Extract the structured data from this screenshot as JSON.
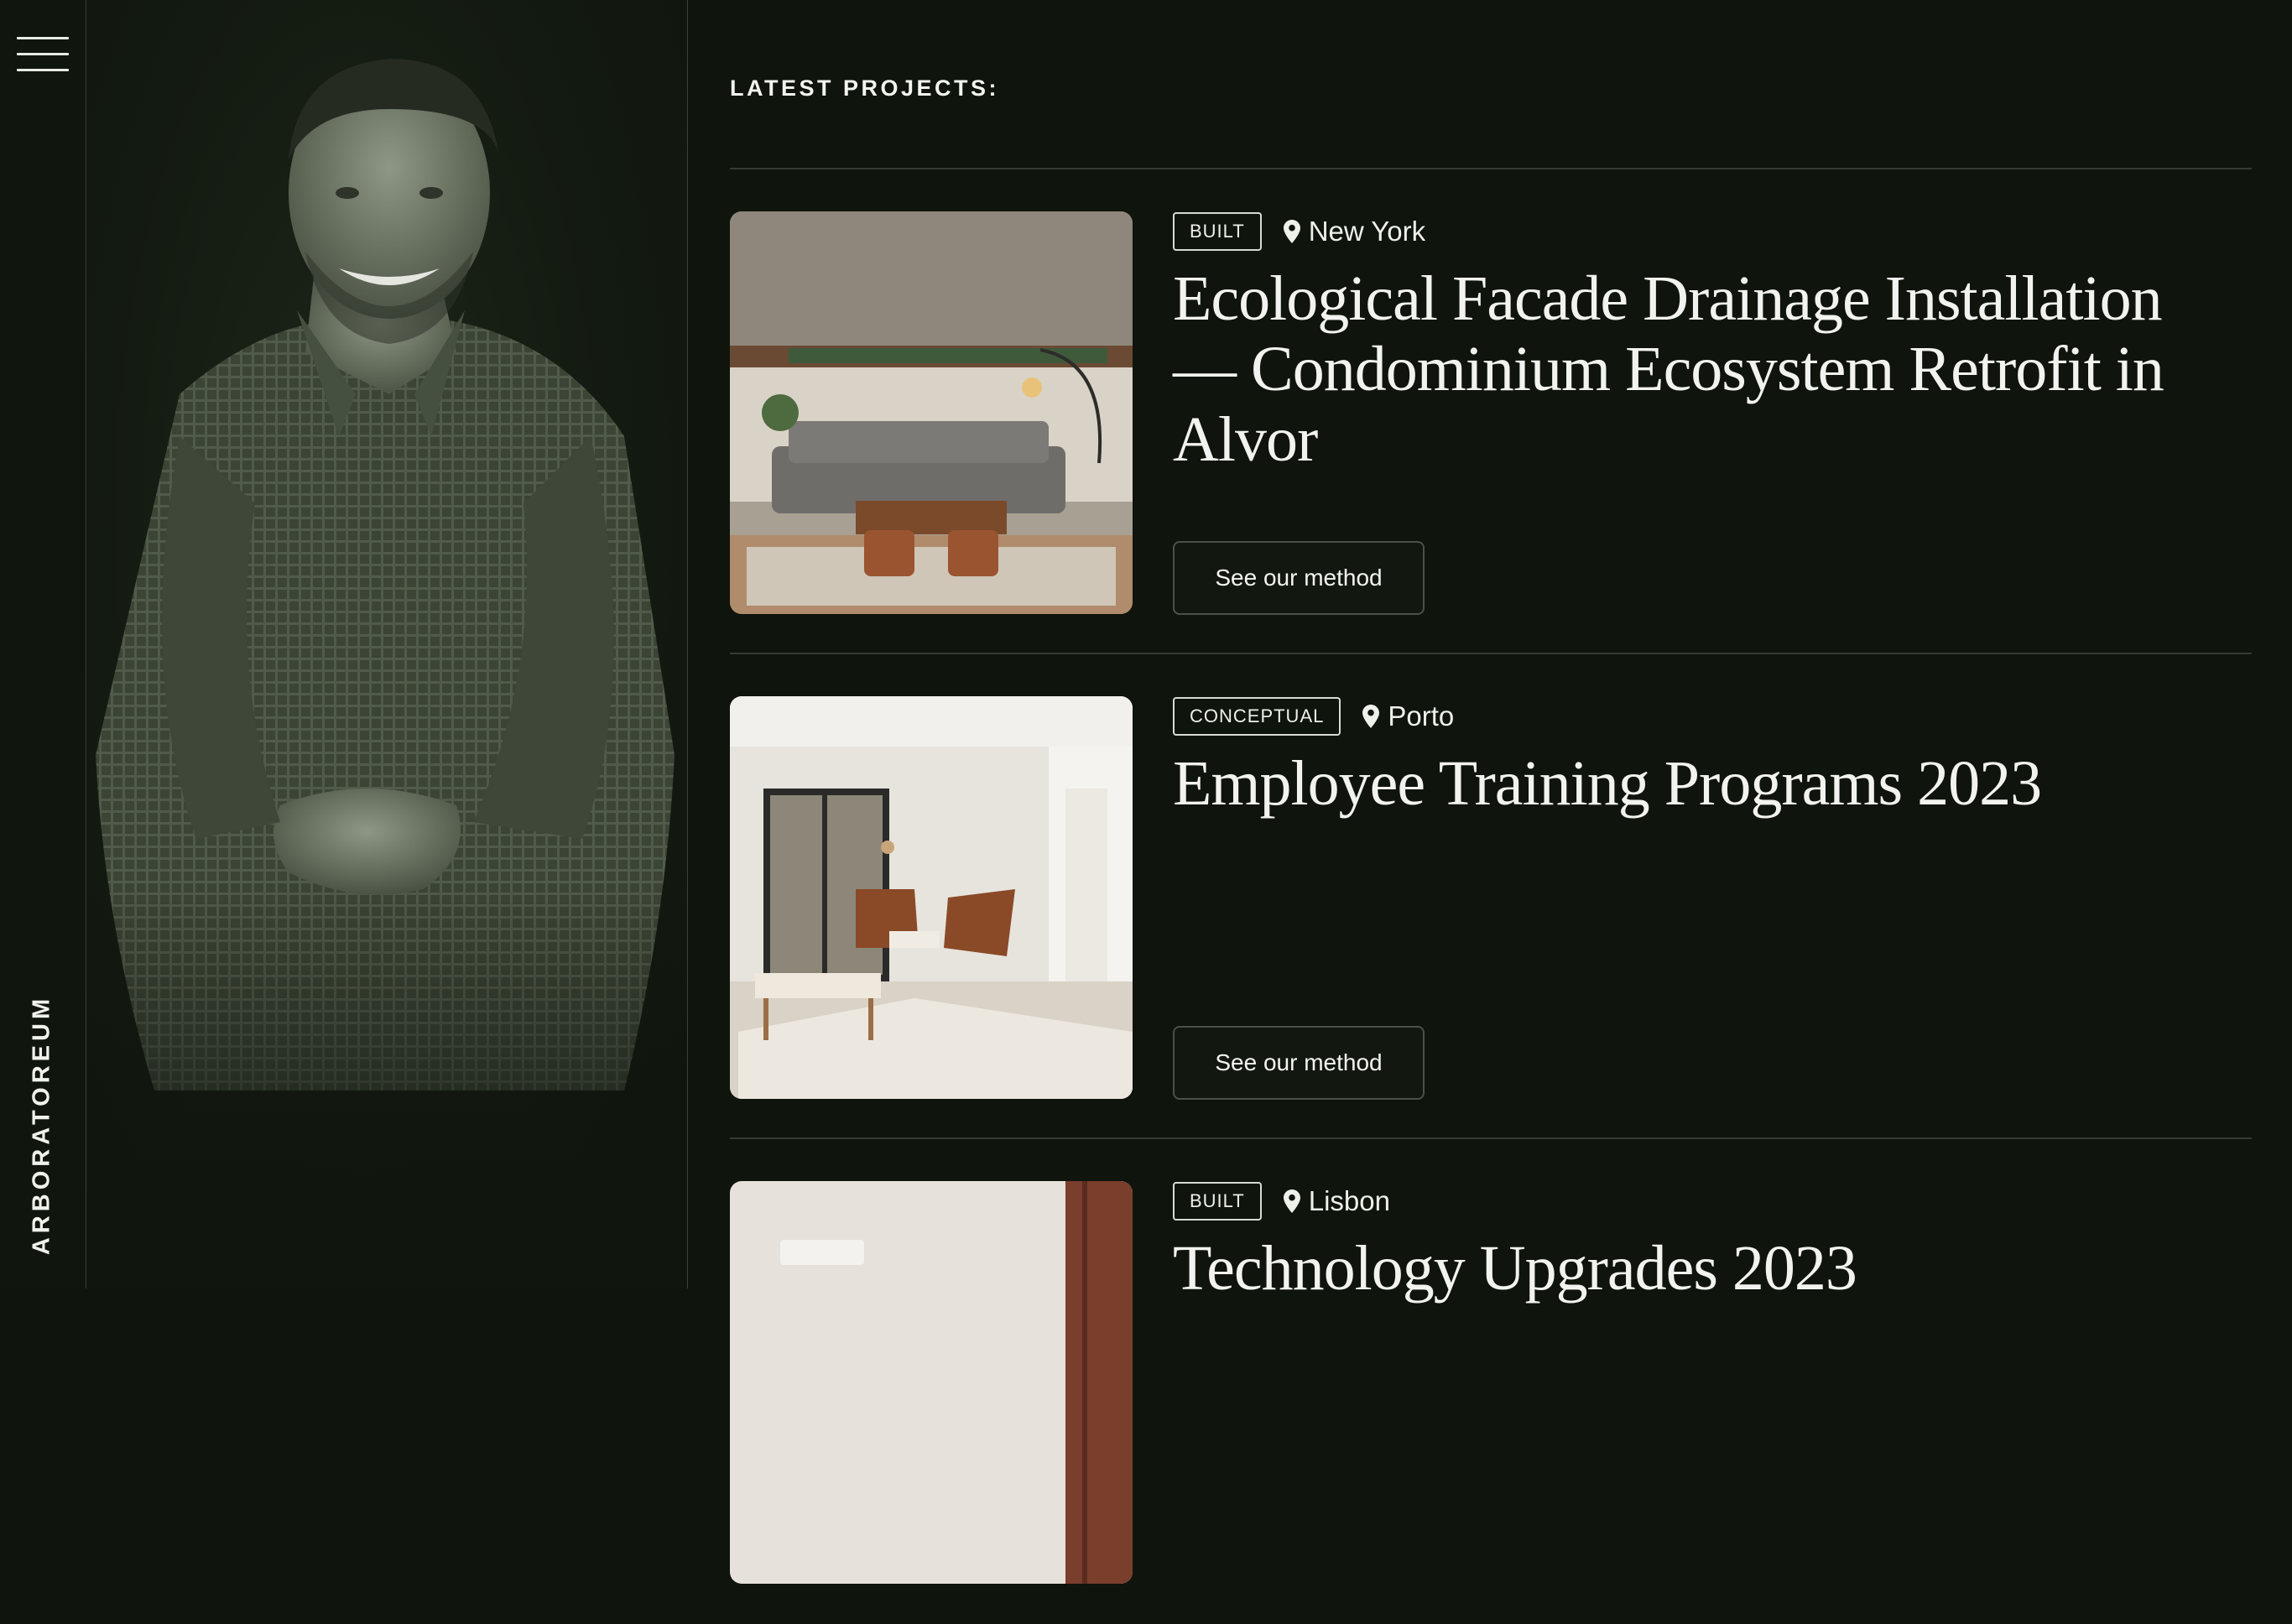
{
  "brand": {
    "name": "ARBORATOREUM"
  },
  "nav": {
    "menu_icon": "hamburger-menu-icon"
  },
  "section": {
    "heading": "LATEST PROJECTS:"
  },
  "projects": [
    {
      "status": "BUILT",
      "location": "New York",
      "title": "Ecological Facade Drainage Installation — Condominium Ecosystem Retrofit in Alvor",
      "cta": "See our method",
      "image": "living-room-photo"
    },
    {
      "status": "CONCEPTUAL",
      "location": "Porto",
      "title": "Employee Training Programs 2023",
      "cta": "See our method",
      "image": "lounge-chairs-photo"
    },
    {
      "status": "BUILT",
      "location": "Lisbon",
      "title": "Technology Upgrades 2023",
      "image": "bedroom-photo"
    }
  ],
  "colors": {
    "background": "#0f140d",
    "text": "#eef0ea",
    "divider": "#343c31"
  }
}
